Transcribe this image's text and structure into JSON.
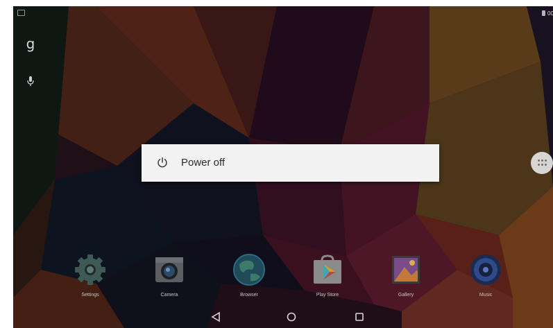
{
  "status_bar": {
    "clock": "00"
  },
  "dialog": {
    "power_off_label": "Power off"
  },
  "dock": {
    "apps": [
      {
        "label": "Settings",
        "icon": "settings-icon"
      },
      {
        "label": "Camera",
        "icon": "camera-icon"
      },
      {
        "label": "Browser",
        "icon": "browser-icon"
      },
      {
        "label": "Play Store",
        "icon": "play-store-icon"
      },
      {
        "label": "Gallery",
        "icon": "gallery-icon"
      },
      {
        "label": "Music",
        "icon": "music-icon"
      }
    ]
  },
  "nav_bar": {
    "buttons": [
      "back-icon",
      "home-icon",
      "recents-icon"
    ]
  },
  "colors": {
    "dialog_background": "#f2f2f2",
    "dim_overlay": "rgba(0,0,0,0.45)"
  }
}
